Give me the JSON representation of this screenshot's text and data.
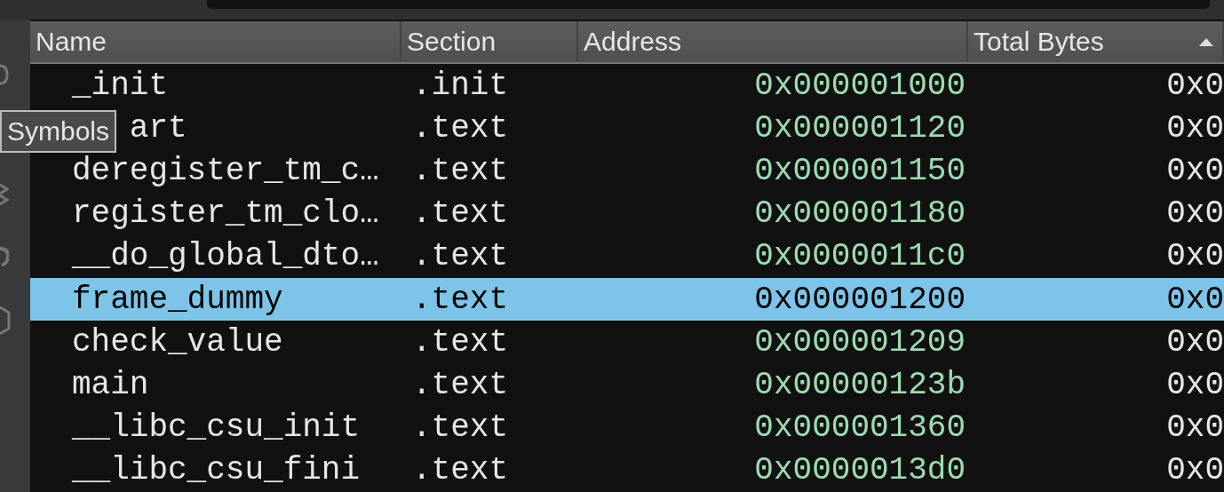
{
  "table": {
    "columns": [
      {
        "label": "Name"
      },
      {
        "label": "Section"
      },
      {
        "label": "Address"
      },
      {
        "label": "Total Bytes",
        "sorted": true
      }
    ],
    "rows": [
      {
        "name": "_init",
        "section": ".init",
        "address": "0x000001000",
        "total_bytes": "0x0",
        "selected": false,
        "covered": false
      },
      {
        "name": "art",
        "section": ".text",
        "address": "0x000001120",
        "total_bytes": "0x0",
        "selected": false,
        "covered": true
      },
      {
        "name": "deregister_tm_c…",
        "section": ".text",
        "address": "0x000001150",
        "total_bytes": "0x0",
        "selected": false,
        "covered": false
      },
      {
        "name": "register_tm_clo…",
        "section": ".text",
        "address": "0x000001180",
        "total_bytes": "0x0",
        "selected": false,
        "covered": false
      },
      {
        "name": "__do_global_dto…",
        "section": ".text",
        "address": "0x0000011c0",
        "total_bytes": "0x0",
        "selected": false,
        "covered": false
      },
      {
        "name": "frame_dummy",
        "section": ".text",
        "address": "0x000001200",
        "total_bytes": "0x0",
        "selected": true,
        "covered": false
      },
      {
        "name": "check_value",
        "section": ".text",
        "address": "0x000001209",
        "total_bytes": "0x0",
        "selected": false,
        "covered": false
      },
      {
        "name": "main",
        "section": ".text",
        "address": "0x00000123b",
        "total_bytes": "0x0",
        "selected": false,
        "covered": false
      },
      {
        "name": "__libc_csu_init",
        "section": ".text",
        "address": "0x000001360",
        "total_bytes": "0x0",
        "selected": false,
        "covered": false
      },
      {
        "name": "__libc_csu_fini",
        "section": ".text",
        "address": "0x0000013d0",
        "total_bytes": "0x0",
        "selected": false,
        "covered": false
      }
    ]
  },
  "tooltip": {
    "text": "Symbols"
  }
}
